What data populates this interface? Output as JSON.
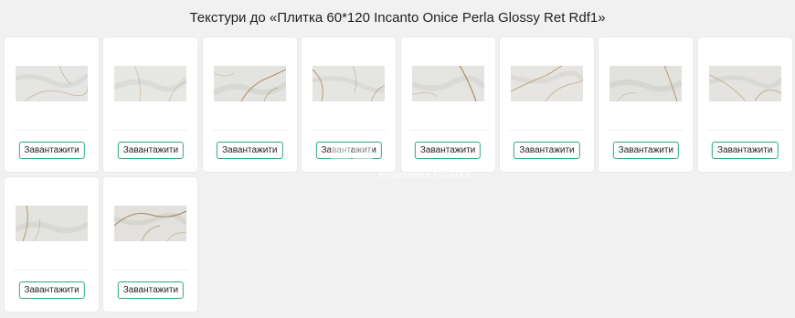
{
  "page": {
    "title": "Текстури до «Плитка 60*120 Incanto Onice Perla Glossy Ret Rdf1»"
  },
  "textures": [
    {
      "variant": 1,
      "button_label": "Завантажити"
    },
    {
      "variant": 2,
      "button_label": "Завантажити"
    },
    {
      "variant": 3,
      "button_label": "Завантажити"
    },
    {
      "variant": 4,
      "button_label": "Завантажити"
    },
    {
      "variant": 5,
      "button_label": "Завантажити"
    },
    {
      "variant": 6,
      "button_label": "Завантажити"
    },
    {
      "variant": 7,
      "button_label": "Завантажити"
    },
    {
      "variant": 8,
      "button_label": "Завантажити"
    },
    {
      "variant": 9,
      "button_label": "Завантажити"
    },
    {
      "variant": 10,
      "button_label": "Завантажити"
    }
  ],
  "watermark": {
    "text": "Керамічна Плитка"
  },
  "colors": {
    "background": "#f1f1f1",
    "card": "#ffffff",
    "button_border": "#2eaa7a",
    "marble_base": "#e6e6e3",
    "marble_vein": "#b89a72"
  }
}
